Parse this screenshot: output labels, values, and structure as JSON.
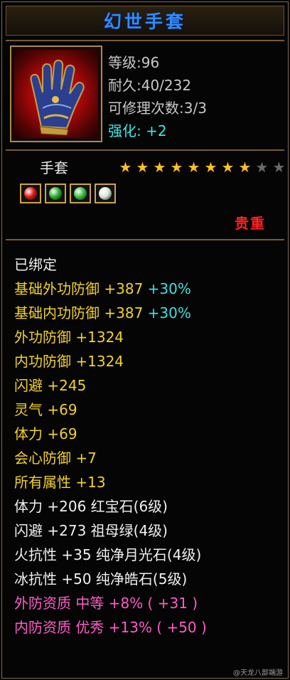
{
  "title": "幻世手套",
  "stats": {
    "level": "等级:96",
    "durability": "耐久:40/232",
    "repair": "可修理次数:3/3",
    "enhance": "强化: +2"
  },
  "item_type": "手套",
  "stars": {
    "filled": 8,
    "total": 10
  },
  "gems": [
    {
      "name": "ruby-gem-icon",
      "color": "#e01818"
    },
    {
      "name": "emerald-gem-icon",
      "color": "#2fb02f"
    },
    {
      "name": "emerald-gem-icon",
      "color": "#3cc04a"
    },
    {
      "name": "pearl-gem-icon",
      "color": "#d8e8d8"
    }
  ],
  "rarity": "贵重",
  "bound": "已绑定",
  "base_attrs": [
    {
      "text": "基础外功防御 +387",
      "bonus": "+30%"
    },
    {
      "text": "基础内功防御 +387",
      "bonus": "+30%"
    }
  ],
  "attrs": [
    "外功防御 +1324",
    "内功防御 +1324",
    "闪避 +245",
    "灵气 +69",
    "体力 +69",
    "会心防御 +7",
    "所有属性 +13"
  ],
  "gem_attrs": [
    "体力 +206 红宝石(6级)",
    "闪避 +273 祖母绿(4级)",
    "火抗性 +35 纯净月光石(4级)",
    "冰抗性 +50 纯净皓石(5级)"
  ],
  "qualities": [
    "外防资质 中等 +8% ( +31 )",
    "内防资质 优秀 +13% ( +50 )"
  ],
  "watermark": "@天龙八部端游"
}
